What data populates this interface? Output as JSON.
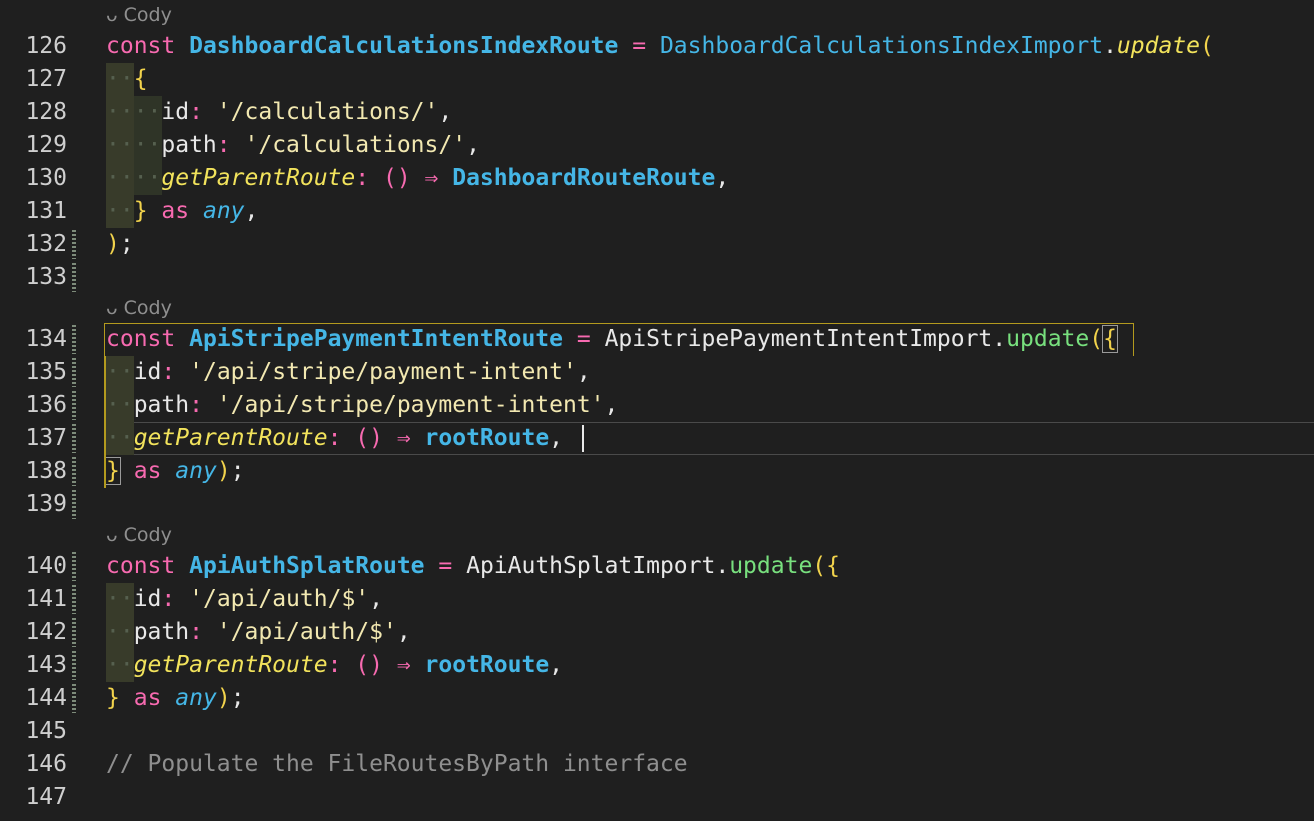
{
  "lenses": {
    "l1": {
      "icon": "ᴗ",
      "label": "Cody"
    },
    "l2": {
      "icon": "ᴗ",
      "label": "Cody"
    },
    "l3": {
      "icon": "ᴗ",
      "label": "Cody"
    }
  },
  "lines": {
    "n126": "126",
    "n127": "127",
    "n128": "128",
    "n129": "129",
    "n130": "130",
    "n131": "131",
    "n132": "132",
    "n133": "133",
    "n134": "134",
    "n135": "135",
    "n136": "136",
    "n137": "137",
    "n138": "138",
    "n139": "139",
    "n140": "140",
    "n141": "141",
    "n142": "142",
    "n143": "143",
    "n144": "144",
    "n145": "145",
    "n146": "146",
    "n147": "147"
  },
  "tok": {
    "const": "const",
    "as": "as",
    "any": "any",
    "arrow": "() ⇒",
    "update": "update",
    "id": "id",
    "path": "path",
    "getParentRoute": "getParentRoute",
    "dashRoute": "DashboardCalculationsIndexRoute",
    "dashImport": "DashboardCalculationsIndexImport",
    "dashRouteRoute": "DashboardRouteRoute",
    "calcStr": "'/calculations/'",
    "stripeRoute": "ApiStripePaymentIntentRoute",
    "stripeImport": "ApiStripePaymentIntentImport",
    "stripeStr": "'/api/stripe/payment-intent'",
    "rootRoute": "rootRoute",
    "authRoute": "ApiAuthSplatRoute",
    "authImport": "ApiAuthSplatImport",
    "authStr": "'/api/auth/$'",
    "comment": "// Populate the FileRoutesByPath interface"
  }
}
